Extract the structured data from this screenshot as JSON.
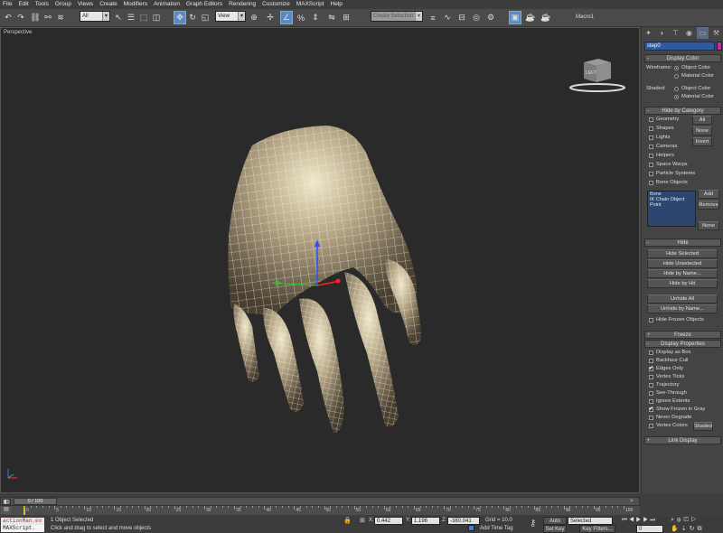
{
  "menu": [
    "File",
    "Edit",
    "Tools",
    "Group",
    "Views",
    "Create",
    "Modifiers",
    "Animation",
    "Graph Editors",
    "Rendering",
    "Customize",
    "MAXScript",
    "Help"
  ],
  "toolbar": {
    "selection_filter": "All",
    "ref_coord": "View",
    "named_selection_placeholder": "Create Selection Se",
    "macro_label": "Macro1",
    "icons": [
      "undo-icon",
      "redo-icon",
      "link-icon",
      "unlink-icon",
      "bind-icon",
      "select-icon",
      "select-by-name-icon",
      "region-icon",
      "window-crossing-icon",
      "move-icon",
      "rotate-icon",
      "scale-icon",
      "pivot-icon",
      "snap-icon",
      "angle-snap-icon",
      "percent-snap-icon",
      "spinner-snap-icon",
      "mirror-icon",
      "align-icon",
      "layers-icon",
      "curve-editor-icon",
      "schematic-icon",
      "material-editor-icon",
      "render-setup-icon",
      "render-frame-icon",
      "render-icon"
    ]
  },
  "viewport": {
    "label": "Perspective",
    "viewcube_label": "LEFT"
  },
  "command_panel": {
    "tabs": [
      "create",
      "modify",
      "hierarchy",
      "motion",
      "display",
      "utilities"
    ],
    "object_name": "step0",
    "object_color": "#c02ab0",
    "display_color": {
      "title": "Display Color",
      "wireframe_label": "Wireframe:",
      "shaded_label": "Shaded:",
      "object_color": "Object Color",
      "material_color": "Material Color"
    },
    "hide_by_category": {
      "title": "Hide by Category",
      "items": [
        "Geometry",
        "Shapes",
        "Lights",
        "Cameras",
        "Helpers",
        "Space Warps",
        "Particle Systems",
        "Bone Objects"
      ],
      "all": "All",
      "none": "None",
      "invert": "Invert",
      "list": [
        "Bone",
        "IK Chain Object",
        "Point"
      ],
      "add": "Add",
      "remove": "Remove",
      "none2": "None"
    },
    "hide": {
      "title": "Hide",
      "hide_selected": "Hide Selected",
      "hide_unselected": "Hide Unselected",
      "hide_by_name": "Hide by Name...",
      "hide_by_hit": "Hide by Hit",
      "unhide_all": "Unhide All",
      "unhide_by_name": "Unhide by Name...",
      "hide_frozen": "Hide Frozen Objects"
    },
    "freeze": {
      "title": "Freeze"
    },
    "display_properties": {
      "title": "Display Properties",
      "items": [
        "Display as Box",
        "Backface Cull",
        "Edges Only",
        "Vertex Ticks",
        "Trajectory",
        "See-Through",
        "Ignore Extents",
        "Show Frozen in Gray",
        "Never Degrade",
        "Vertex Colors"
      ],
      "checked": [
        false,
        false,
        true,
        false,
        false,
        false,
        false,
        true,
        false,
        false
      ],
      "shaded": "Shaded"
    },
    "link_display": {
      "title": "Link Display"
    }
  },
  "timeline": {
    "frame_display": "0 / 100",
    "ticks": [
      "0",
      "5",
      "10",
      "15",
      "20",
      "25",
      "30",
      "35",
      "40",
      "45",
      "50",
      "55",
      "60",
      "65",
      "70",
      "75",
      "80",
      "85",
      "90",
      "95",
      "100"
    ]
  },
  "status": {
    "maxscript_lines": [
      "actionMan.ex",
      "MAXScript."
    ],
    "objects_selected": "1 Object Selected",
    "prompt": "Click and drag to select and move objects",
    "x_label": "X:",
    "x_value": "0.442",
    "y_label": "Y:",
    "y_value": "1.196",
    "z_label": "Z:",
    "z_value": "-380.041",
    "grid": "Grid = 10.0",
    "add_time_tag": "Add Time Tag",
    "auto_key": "Auto Key",
    "auto_key_value": "Selected",
    "set_key": "Set Key",
    "key_filters": "Key Filters...",
    "current_frame": "0"
  }
}
